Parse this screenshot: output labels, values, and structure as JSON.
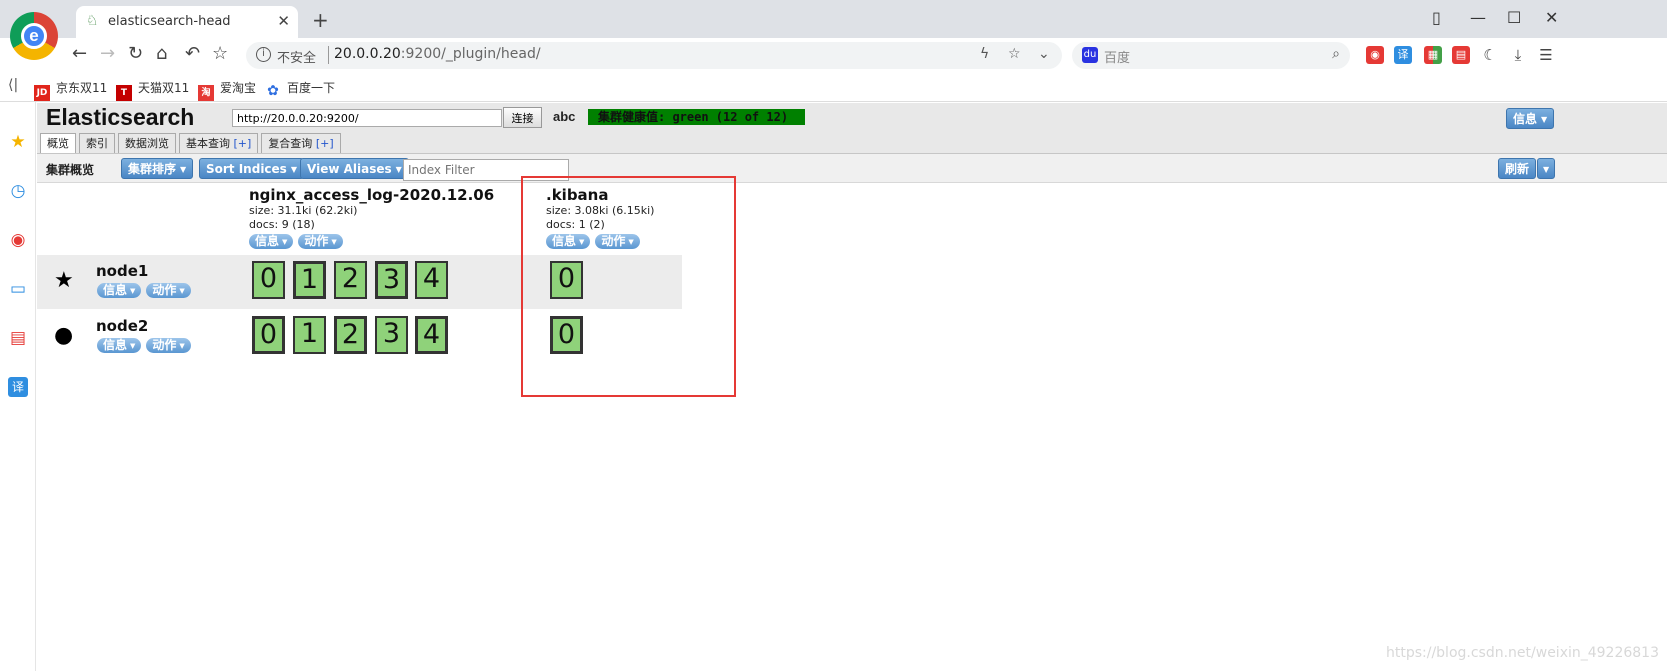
{
  "browser": {
    "tab_title": "elasticsearch-head",
    "insecure_label": "不安全",
    "url_host": "20.0.0.20",
    "url_rest": ":9200/_plugin/head/",
    "search_placeholder": "百度",
    "bookmarks": [
      "京东双11",
      "天猫双11",
      "爱淘宝",
      "百度一下"
    ],
    "bookmark_icons": [
      "JD",
      "T",
      "淘",
      ""
    ]
  },
  "header": {
    "brand": "Elasticsearch",
    "connect_url": "http://20.0.0.20:9200/",
    "connect_label": "连接",
    "cluster_name": "abc",
    "health": "集群健康值: green (12 of 12)",
    "info_label": "信息",
    "tabs": [
      {
        "label": "概览",
        "plus": ""
      },
      {
        "label": "索引",
        "plus": ""
      },
      {
        "label": "数据浏览",
        "plus": ""
      },
      {
        "label": "基本查询",
        "plus": "[+]"
      },
      {
        "label": "复合查询",
        "plus": "[+]"
      }
    ]
  },
  "subbar": {
    "title": "集群概览",
    "sort_cluster": "集群排序",
    "sort_indices": "Sort Indices",
    "view_aliases": "View Aliases",
    "filter_placeholder": "Index Filter",
    "refresh": "刷新"
  },
  "pills": {
    "info": "信息",
    "action": "动作"
  },
  "indices": [
    {
      "name": "nginx_access_log-2020.12.06",
      "size": "size: 31.1ki (62.2ki)",
      "docs": "docs: 9 (18)"
    },
    {
      "name": ".kibana",
      "size": "size: 3.08ki (6.15ki)",
      "docs": "docs: 1 (2)"
    }
  ],
  "nodes": [
    {
      "name": "node1",
      "shards_a": [
        "0",
        "1",
        "2",
        "3",
        "4"
      ],
      "shards_b": [
        "0"
      ]
    },
    {
      "name": "node2",
      "shards_a": [
        "0",
        "1",
        "2",
        "3",
        "4"
      ],
      "shards_b": [
        "0"
      ]
    }
  ],
  "watermark": "https://blog.csdn.net/weixin_49226813",
  "colors": {
    "health": "#008000",
    "shard": "#8fd27a",
    "highlight": "#e53935"
  }
}
